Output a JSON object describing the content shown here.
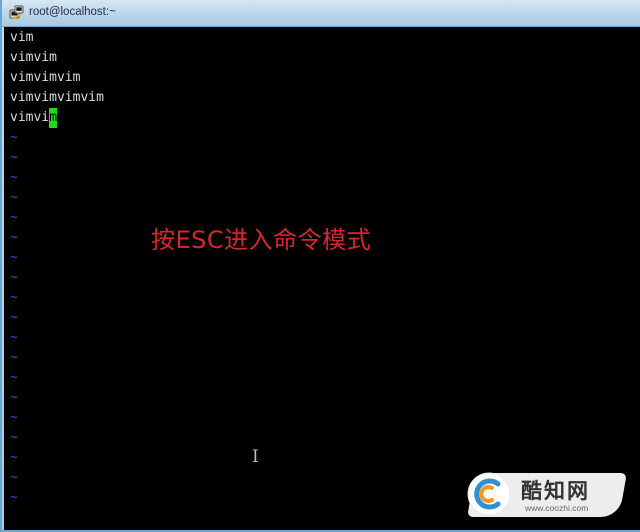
{
  "window": {
    "title": "root@localhost:~"
  },
  "editor": {
    "lines": [
      "vim",
      "vimvim",
      "vimvimvim",
      "vimvimvimvim"
    ],
    "cursor_line_prefix": "vimvi",
    "cursor_char": "m",
    "tilde_char": "~",
    "tilde_count": 19,
    "colors": {
      "background": "#000000",
      "text": "#d9d9d9",
      "cursor": "#22d81a",
      "tilde": "#3f4ec7"
    }
  },
  "annotation": {
    "text": "按ESC进入命令模式",
    "color": "#d6262d"
  },
  "mouse_cursor": {
    "icon": "text-ibeam-cursor-icon",
    "glyph": "I"
  },
  "watermark": {
    "name": "酷知网",
    "url": "www.coozhi.com",
    "icon": "coozhi-logo-icon"
  }
}
